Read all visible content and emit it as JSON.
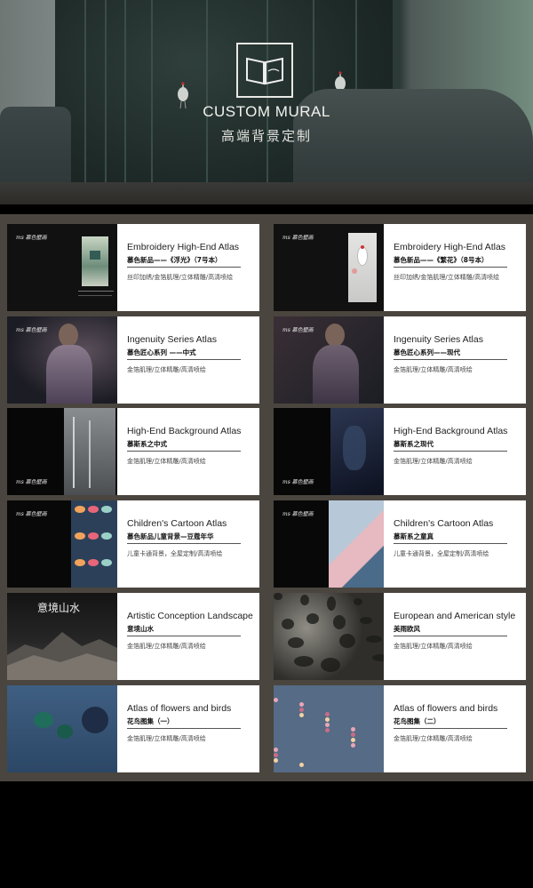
{
  "hero": {
    "title": "CUSTOM MURAL",
    "subtitle": "高端背景定制"
  },
  "brand": {
    "mark": "ms",
    "name": "慕色壁画"
  },
  "cards": [
    {
      "en": "Embroidery High-End Atlas",
      "cn": "慕色新品——《浮光》（7号本）",
      "features": "丝印加绣/金箔肌理/立体精雕/高清喷绘",
      "thumb": "embroidery-green"
    },
    {
      "en": "Embroidery High-End Atlas",
      "cn": "慕色新品——《繁花》（8号本）",
      "features": "丝印加绣/金箔肌理/立体精雕/高清喷绘",
      "thumb": "embroidery-crane"
    },
    {
      "en": "Ingenuity Series Atlas",
      "cn": "慕色匠心系列 ——中式",
      "features": "金箔肌理/立体精雕/高清喷绘",
      "thumb": "ingenuity-chinese"
    },
    {
      "en": "Ingenuity Series Atlas",
      "cn": "慕色匠心系列——现代",
      "features": "金箔肌理/立体精雕/高清喷绘",
      "thumb": "ingenuity-modern"
    },
    {
      "en": "High-End Background Atlas",
      "cn": "慕斯系之中式",
      "features": "金箔肌理/立体精雕/高清喷绘",
      "thumb": "background-chinese"
    },
    {
      "en": "High-End Background Atlas",
      "cn": "慕斯系之现代",
      "features": "金箔肌理/立体精雕/高清喷绘",
      "thumb": "background-modern"
    },
    {
      "en": "Children's Cartoon Atlas",
      "cn": "慕色新品儿童背景—豆蔻年华",
      "features": "儿童卡通背景，全屋定制/高清喷绘",
      "thumb": "cartoon-fish"
    },
    {
      "en": "Children's Cartoon Atlas",
      "cn": "慕斯系之童真",
      "features": "儿童卡通背景，全屋定制/高清喷绘",
      "thumb": "cartoon-geo"
    },
    {
      "en": "Artistic Conception Landscape",
      "cn": "意境山水",
      "features": "金箔肌理/立体精雕/高清喷绘",
      "thumb": "landscape",
      "thumb_label": "意境山水"
    },
    {
      "en": "European and American style",
      "cn": "美雨欧风",
      "features": "金箔肌理/立体精雕/高清喷绘",
      "thumb": "european"
    },
    {
      "en": "Atlas of flowers and birds",
      "cn": "花鸟图集（一）",
      "features": "金箔肌理/立体精雕/高清喷绘",
      "thumb": "birds-blue"
    },
    {
      "en": "Atlas of flowers and birds",
      "cn": "花鸟图集（二）",
      "features": "金箔肌理/立体精雕/高清喷绘",
      "thumb": "birds-pink"
    }
  ],
  "colors": {
    "catalog_bg": "#4a453e",
    "card_bg": "#ffffff",
    "hero_text": "#f2f2ee"
  }
}
